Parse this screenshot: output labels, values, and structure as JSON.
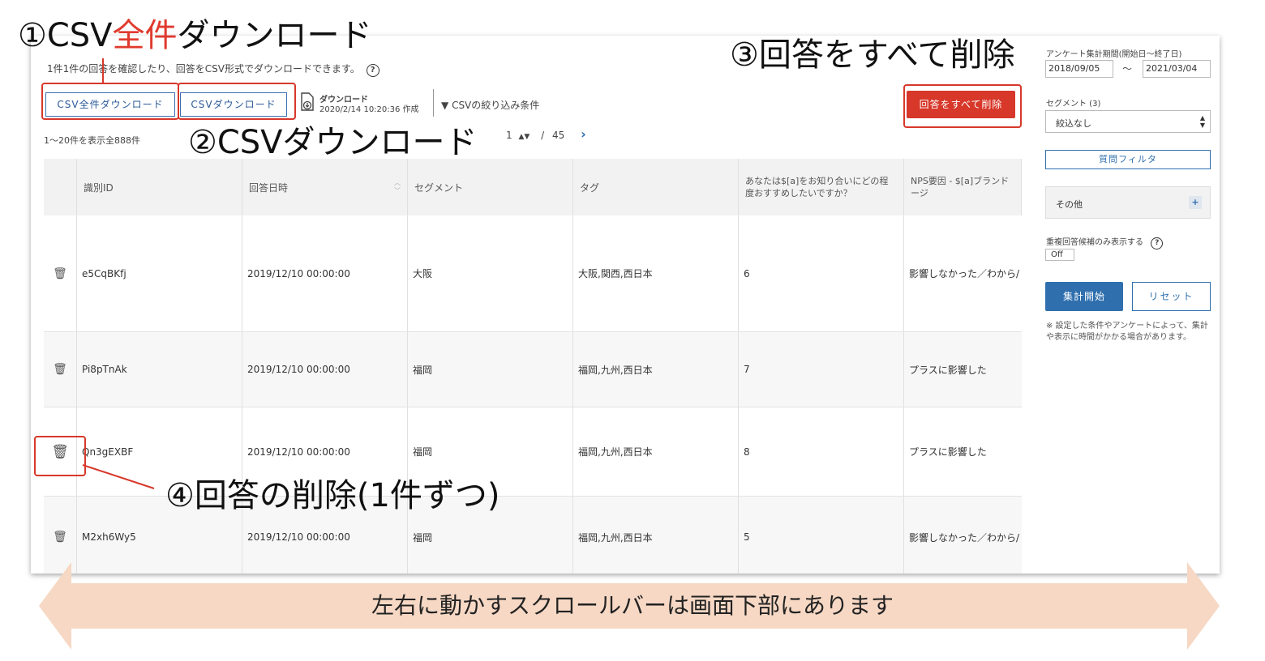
{
  "annotations": {
    "a1_prefix": "①CSV",
    "a1_red": "全件",
    "a1_suffix": "ダウンロード",
    "a2": "②CSVダウンロード",
    "a3": "③回答をすべて削除",
    "a4": "④回答の削除(1件ずつ)",
    "scroll_note": "左右に動かすスクロールバーは画面下部にあります"
  },
  "header": {
    "description": "1件1件の回答を確認したり、回答をCSV形式でダウンロードできます。",
    "help_icon": "question-circle-icon"
  },
  "toolbar": {
    "csv_all_label": "CSV全件ダウンロード",
    "csv_label": "CSVダウンロード",
    "download_title": "ダウンロード",
    "download_date": "2020/2/14 10:20:36 作成",
    "filter_label": "CSVの絞り込み条件",
    "delete_all_label": "回答をすべて削除"
  },
  "paging": {
    "summary": "1〜20件を表示全888件",
    "current_page": "1",
    "separator": "/",
    "total_pages": "45",
    "next_icon": "chevron-right-icon"
  },
  "table": {
    "headers": [
      "識別ID",
      "回答日時",
      "セグメント",
      "タグ",
      "あなたは$[a]をお知り合いにどの程度おすすめしたいですか？",
      "NPS要因 - $[a]ブランドージ"
    ],
    "rows": [
      {
        "id": "e5CqBKfj",
        "date": "2019/12/10 00:00:00",
        "segment": "大阪",
        "tags": "大阪,関西,西日本",
        "score": "6",
        "nps": "影響しなかった／わから/"
      },
      {
        "id": "Pi8pTnAk",
        "date": "2019/12/10 00:00:00",
        "segment": "福岡",
        "tags": "福岡,九州,西日本",
        "score": "7",
        "nps": "プラスに影響した"
      },
      {
        "id": "Qn3gEXBF",
        "date": "2019/12/10 00:00:00",
        "segment": "福岡",
        "tags": "福岡,九州,西日本",
        "score": "8",
        "nps": "プラスに影響した"
      },
      {
        "id": "M2xh6Wy5",
        "date": "2019/12/10 00:00:00",
        "segment": "福岡",
        "tags": "福岡,九州,西日本",
        "score": "5",
        "nps": "影響しなかった／わから/"
      }
    ]
  },
  "sidebar": {
    "period_label": "アンケート集計期間(開始日〜終了日)",
    "start_date": "2018/09/05",
    "tilde": "〜",
    "end_date": "2021/03/04",
    "segment_label": "セグメント (3)",
    "segment_value": "絞込なし",
    "question_filter": "質問フィルタ",
    "other_label": "その他",
    "duplicate_label": "重複回答候補のみ表示する",
    "toggle_value": "Off",
    "start_button": "集計開始",
    "reset_button": "リセット",
    "note": "※ 設定した条件やアンケートによって、集計や表示に時間がかかる場合があります。"
  },
  "colors": {
    "accent_blue": "#2f6fae",
    "danger_red": "#d7382a",
    "arrow_fill": "#f6d8c4"
  }
}
